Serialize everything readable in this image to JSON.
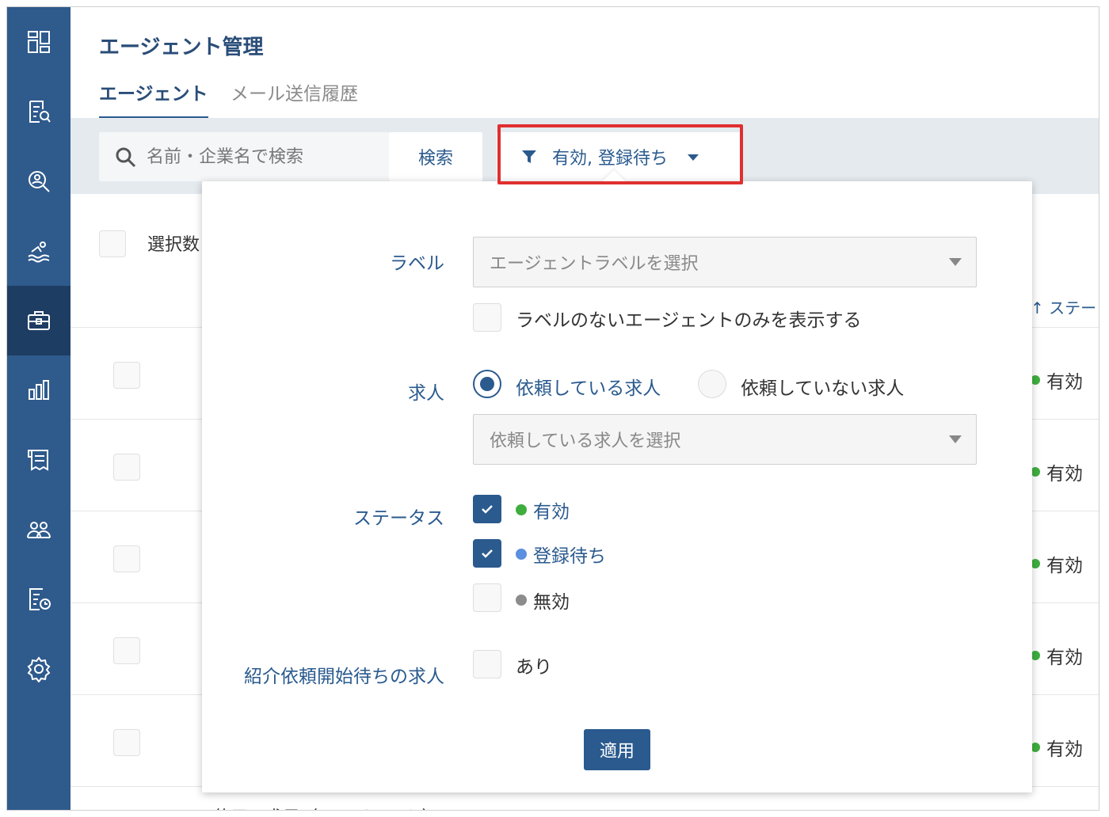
{
  "header": {
    "title": "エージェント管理",
    "tabs": [
      {
        "label": "エージェント",
        "active": true
      },
      {
        "label": "メール送信履歴",
        "active": false
      }
    ]
  },
  "toolbar": {
    "search_placeholder": "名前・企業名で検索",
    "search_button": "検索",
    "filter_summary": "有効, 登録待ち"
  },
  "table": {
    "select_count_label": "選択数",
    "sort_header": "↑ ステー",
    "row_status_values": [
      "有効",
      "有効",
      "有効",
      "有効",
      "有効"
    ],
    "bottom_text": "使用　求目（エージェント）"
  },
  "filter_panel": {
    "label_field": {
      "label": "ラベル",
      "placeholder": "エージェントラベルを選択",
      "only_unlabeled": "ラベルのないエージェントのみを表示する"
    },
    "job_field": {
      "label": "求人",
      "radio_requested": "依頼している求人",
      "radio_not_requested": "依頼していない求人",
      "placeholder": "依頼している求人を選択"
    },
    "status_field": {
      "label": "ステータス",
      "options": [
        {
          "label": "有効",
          "checked": true,
          "color": "#3fae3f"
        },
        {
          "label": "登録待ち",
          "checked": true,
          "color": "#5b8fe0"
        },
        {
          "label": "無効",
          "checked": false,
          "color": "#8c8c8c"
        }
      ]
    },
    "pending_field": {
      "label": "紹介依頼開始待ちの求人",
      "option": "あり"
    },
    "apply_button": "適用"
  },
  "colors": {
    "sidebar": "#2f5a8c",
    "sidebar_active": "#1e3d63",
    "accent": "#2a5a8e",
    "highlight": "#e02f2f"
  },
  "icons": [
    "dashboard-icon",
    "document-search-icon",
    "user-search-icon",
    "swimmer-icon",
    "briefcase-icon",
    "bar-chart-icon",
    "receipt-icon",
    "users-icon",
    "report-icon",
    "gear-icon"
  ]
}
